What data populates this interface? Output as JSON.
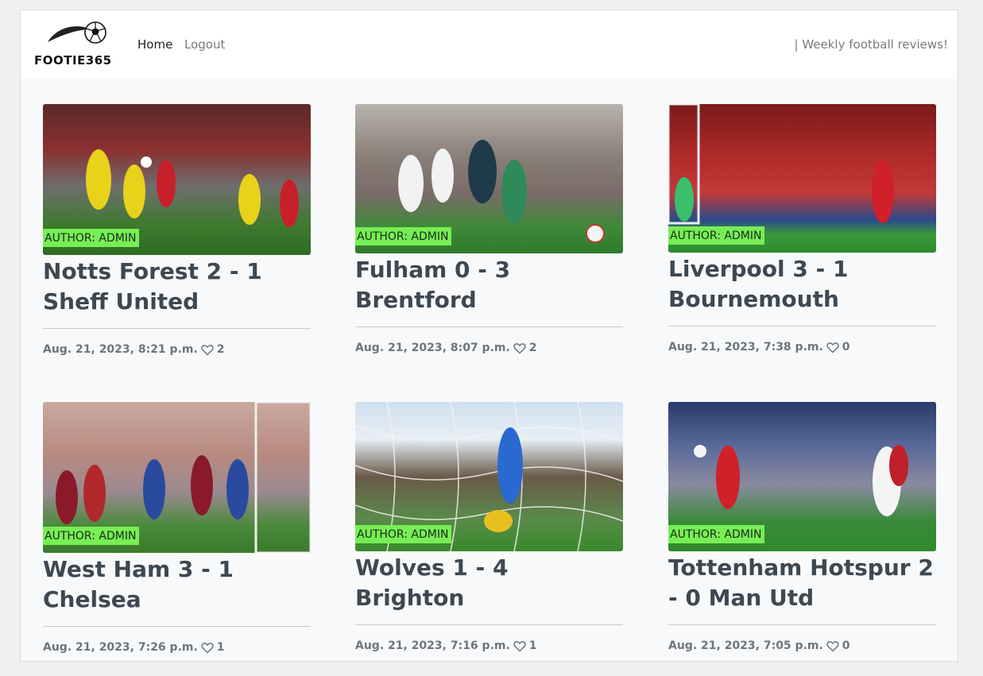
{
  "brand": {
    "name": "FOOTIE365"
  },
  "nav": {
    "home": "Home",
    "logout": "Logout",
    "tagline": "| Weekly football reviews!"
  },
  "posts": [
    {
      "title": "Notts Forest 2 - 1 Sheff United",
      "author": "AUTHOR: ADMIN",
      "date": "Aug. 21, 2023, 8:21 p.m.",
      "likes": "2",
      "image": "pitch-photo-red-yellow"
    },
    {
      "title": "Fulham 0 - 3 Brentford",
      "author": "AUTHOR: ADMIN",
      "date": "Aug. 21, 2023, 8:07 p.m.",
      "likes": "2",
      "image": "pitch-photo-white-green"
    },
    {
      "title": "Liverpool 3 - 1 Bournemouth",
      "author": "AUTHOR: ADMIN",
      "date": "Aug. 21, 2023, 7:38 p.m.",
      "likes": "0",
      "image": "pitch-photo-red-crowd"
    },
    {
      "title": "West Ham 3 - 1 Chelsea",
      "author": "AUTHOR: ADMIN",
      "date": "Aug. 21, 2023, 7:26 p.m.",
      "likes": "1",
      "image": "pitch-photo-claret-blue"
    },
    {
      "title": "Wolves 1 - 4 Brighton",
      "author": "AUTHOR: ADMIN",
      "date": "Aug. 21, 2023, 7:16 p.m.",
      "likes": "1",
      "image": "pitch-photo-goal-net"
    },
    {
      "title": "Tottenham Hotspur 2 - 0 Man Utd",
      "author": "AUTHOR: ADMIN",
      "date": "Aug. 21, 2023, 7:05 p.m.",
      "likes": "0",
      "image": "pitch-photo-white-red"
    }
  ],
  "colors": {
    "author_badge": "#77ee55",
    "title": "#3d4852",
    "meta": "#6c757d"
  }
}
